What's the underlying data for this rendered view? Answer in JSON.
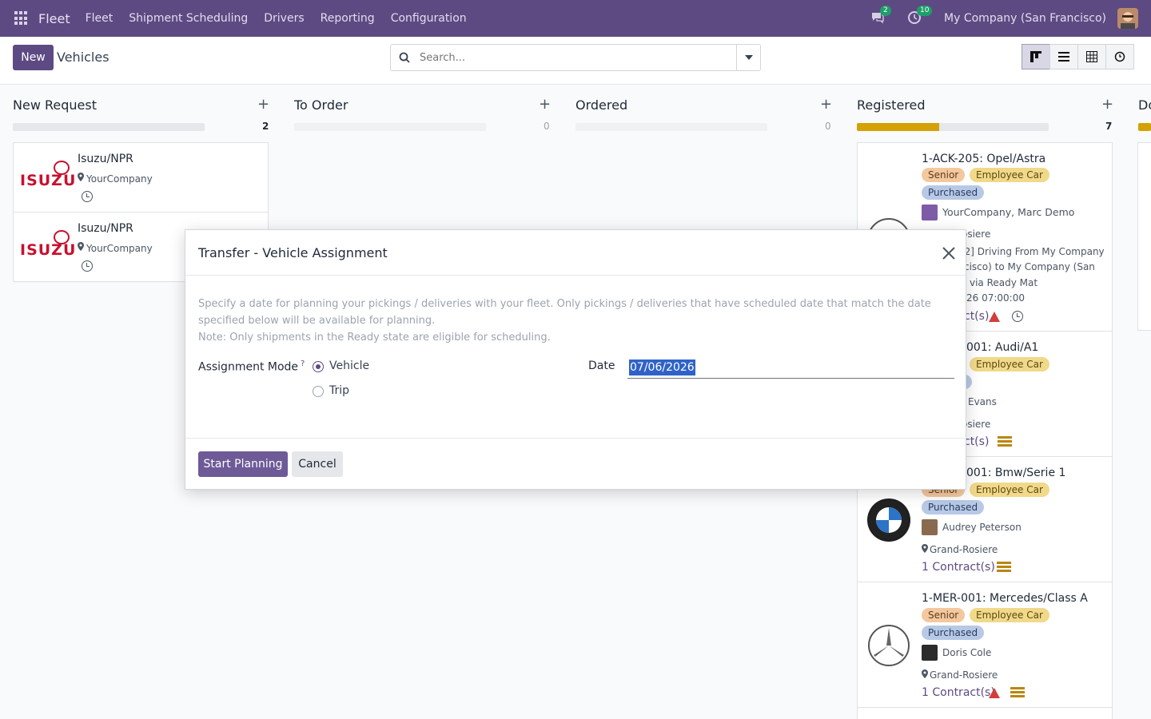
{
  "navbar": {
    "brand": "Fleet",
    "menu": [
      "Fleet",
      "Shipment Scheduling",
      "Drivers",
      "Reporting",
      "Configuration"
    ],
    "messages_badge": "2",
    "activity_badge": "10",
    "company": "My Company (San Francisco)"
  },
  "control": {
    "new_label": "New",
    "breadcrumb": "Vehicles",
    "search_placeholder": "Search..."
  },
  "columns": [
    {
      "title": "New Request",
      "count": "2"
    },
    {
      "title": "To Order",
      "count": "0"
    },
    {
      "title": "Ordered",
      "count": "0"
    },
    {
      "title": "Registered",
      "count": "7",
      "progress": 0.43
    },
    {
      "title": "Do"
    }
  ],
  "new_request_cards": [
    {
      "title": "Isuzu/NPR",
      "location": "YourCompany",
      "logo_text": "ISUZU"
    },
    {
      "title": "Isuzu/NPR",
      "location": "YourCompany",
      "logo_text": "ISUZU"
    }
  ],
  "registered_cards": [
    {
      "title": "1-ACK-205: Opel/Astra",
      "tags": [
        "Senior",
        "Employee Car",
        "Purchased"
      ],
      "driver": "YourCompany, Marc Demo",
      "location": "osiere",
      "trip_line1": "02] Driving From My Company",
      "trip_line2": "cisco) to My Company (San",
      "trip_line3": "via Ready Mat",
      "trip_line4": "26 07:00:00",
      "contracts": "ct(s)"
    },
    {
      "title": "001: Audi/A1",
      "tags": [
        "Employee Car",
        "ed"
      ],
      "driver": "Evans",
      "location": "osiere",
      "contracts": "ct(s)"
    },
    {
      "title": "001: Bmw/Serie 1",
      "tags": [
        "Senior",
        "Employee Car",
        "Purchased"
      ],
      "driver": "Audrey Peterson",
      "location": "Grand-Rosiere",
      "contracts": "1 Contract(s)"
    },
    {
      "title": "1-MER-001: Mercedes/Class A",
      "tags": [
        "Senior",
        "Employee Car",
        "Purchased"
      ],
      "driver": "Doris Cole",
      "location": "Grand-Rosiere",
      "contracts": "1 Contract(s)"
    }
  ],
  "modal": {
    "title": "Transfer - Vehicle Assignment",
    "description_line1": "Specify a date for planning your pickings / deliveries with your fleet. Only pickings / deliveries that have scheduled date that match the date specified below will be available for planning.",
    "description_line2": "Note: Only shipments in the Ready state are eligible for scheduling.",
    "assignment_mode_label": "Assignment Mode",
    "help_mark": "?",
    "options": [
      "Vehicle",
      "Trip"
    ],
    "selected_option": "Vehicle",
    "date_label": "Date",
    "date_value": "07/06/2026",
    "start_label": "Start Planning",
    "cancel_label": "Cancel"
  },
  "colors": {
    "brand": "#5d4a82",
    "progress_registered": "#d4a106"
  }
}
